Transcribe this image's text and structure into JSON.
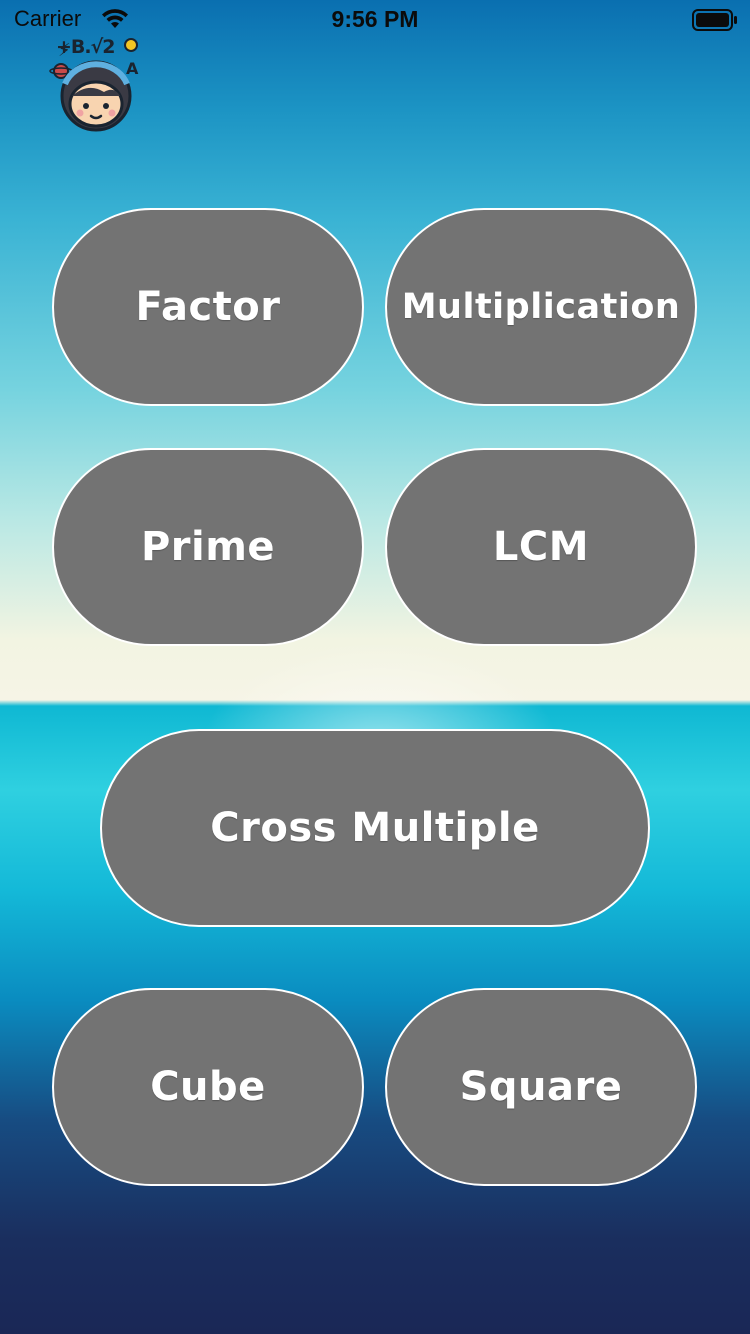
{
  "status_bar": {
    "carrier": "Carrier",
    "time": "9:56 PM",
    "wifi_icon": "wifi-icon",
    "battery_icon": "battery-icon"
  },
  "logo": {
    "icon": "kid-math-logo-icon",
    "text": "+B.√2"
  },
  "menu": {
    "factor": "Factor",
    "multiplication": "Multiplication",
    "prime": "Prime",
    "lcm": "LCM",
    "cross_multiple": "Cross Multiple",
    "cube": "Cube",
    "square": "Square"
  },
  "colors": {
    "button_fill": "#737373",
    "button_border": "#ffffff",
    "button_text": "#ffffff"
  }
}
